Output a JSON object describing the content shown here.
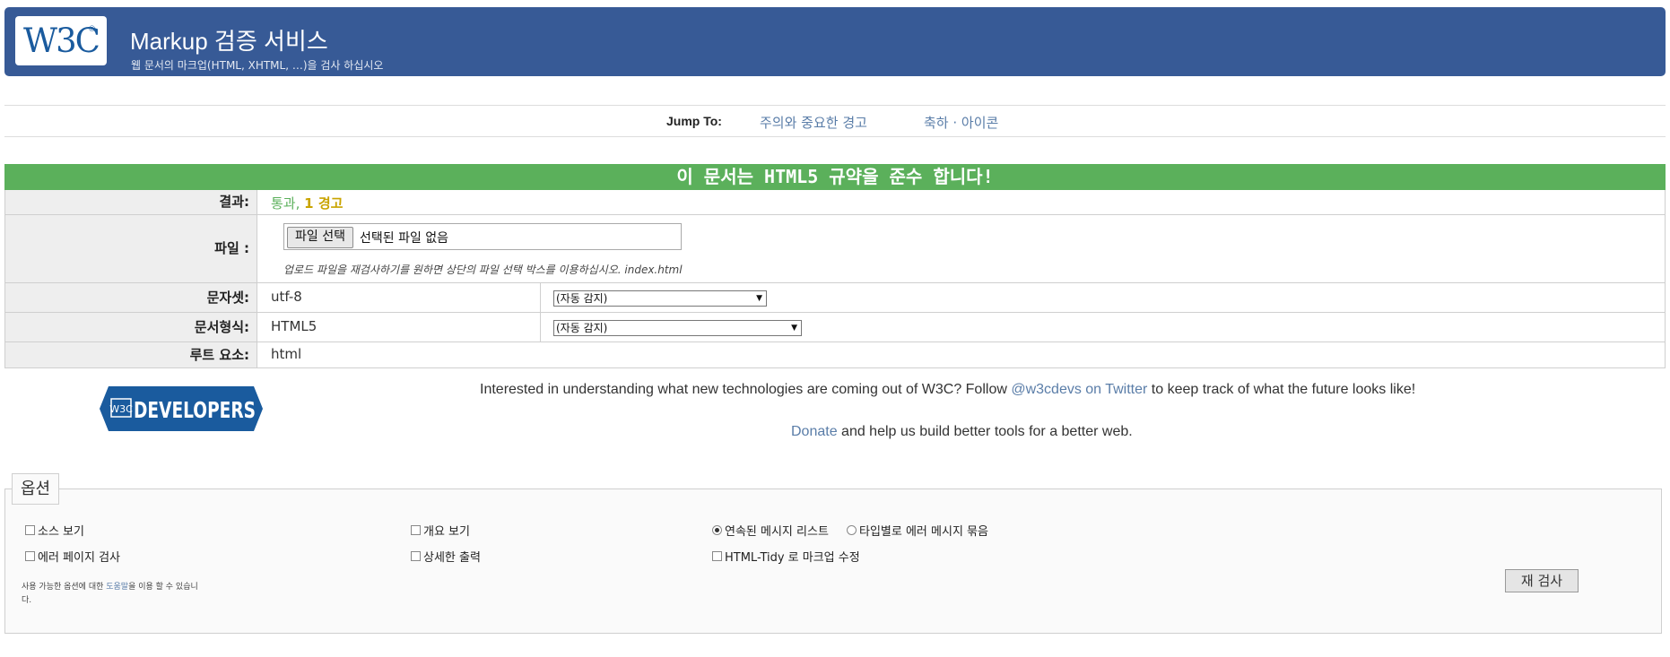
{
  "header": {
    "logo_text": "W3C",
    "logo_reg": "®",
    "title": "Markup 검증 서비스",
    "subtitle": "웹 문서의 마크업(HTML, XHTML, …)을 검사 하십시오"
  },
  "jump": {
    "label": "Jump To:",
    "links": [
      "주의와 중요한 경고",
      "축하 · 아이콘"
    ]
  },
  "result_banner": "이 문서는 HTML5 규약을 준수 합니다!",
  "table": {
    "result_label": "결과:",
    "result_pass": "통과,",
    "result_warn": "1 경고",
    "file_label": "파일 :",
    "file_button": "파일 선택",
    "file_status": "선택된 파일 없음",
    "file_hint": "업로드 파일을 재검사하기를 원하면 상단의 파일 선택 박스를 이용하십시오. index.html",
    "charset_label": "문자셋:",
    "charset_value": "utf-8",
    "charset_select": "(자동 감지)",
    "doctype_label": "문서형식:",
    "doctype_value": "HTML5",
    "doctype_select": "(자동 감지)",
    "root_label": "루트 요소:",
    "root_value": "html"
  },
  "promo": {
    "logo_w3c": "W3C",
    "logo_text": "DEVELOPERS",
    "line1_pre": "Interested in understanding what new technologies are coming out of W3C? Follow ",
    "line1_link": "@w3cdevs on Twitter",
    "line1_post": " to keep track of what the future looks like!",
    "line2_link": "Donate",
    "line2_post": " and help us build better tools for a better web."
  },
  "options": {
    "legend": "옵션",
    "show_source": "소스 보기",
    "show_outline": "개요 보기",
    "list_sequential": "연속된 메시지 리스트",
    "group_by_type": "타입별로 에러 메시지 묶음",
    "error_pages": "에러 페이지 검사",
    "verbose": "상세한 출력",
    "tidy": "HTML-Tidy 로 마크업 수정",
    "help_pre": "사용 가능한 옵션에 대한 ",
    "help_link": "도움말",
    "help_post": "을 이용 할 수 있습니다.",
    "recheck": "재 검사"
  }
}
